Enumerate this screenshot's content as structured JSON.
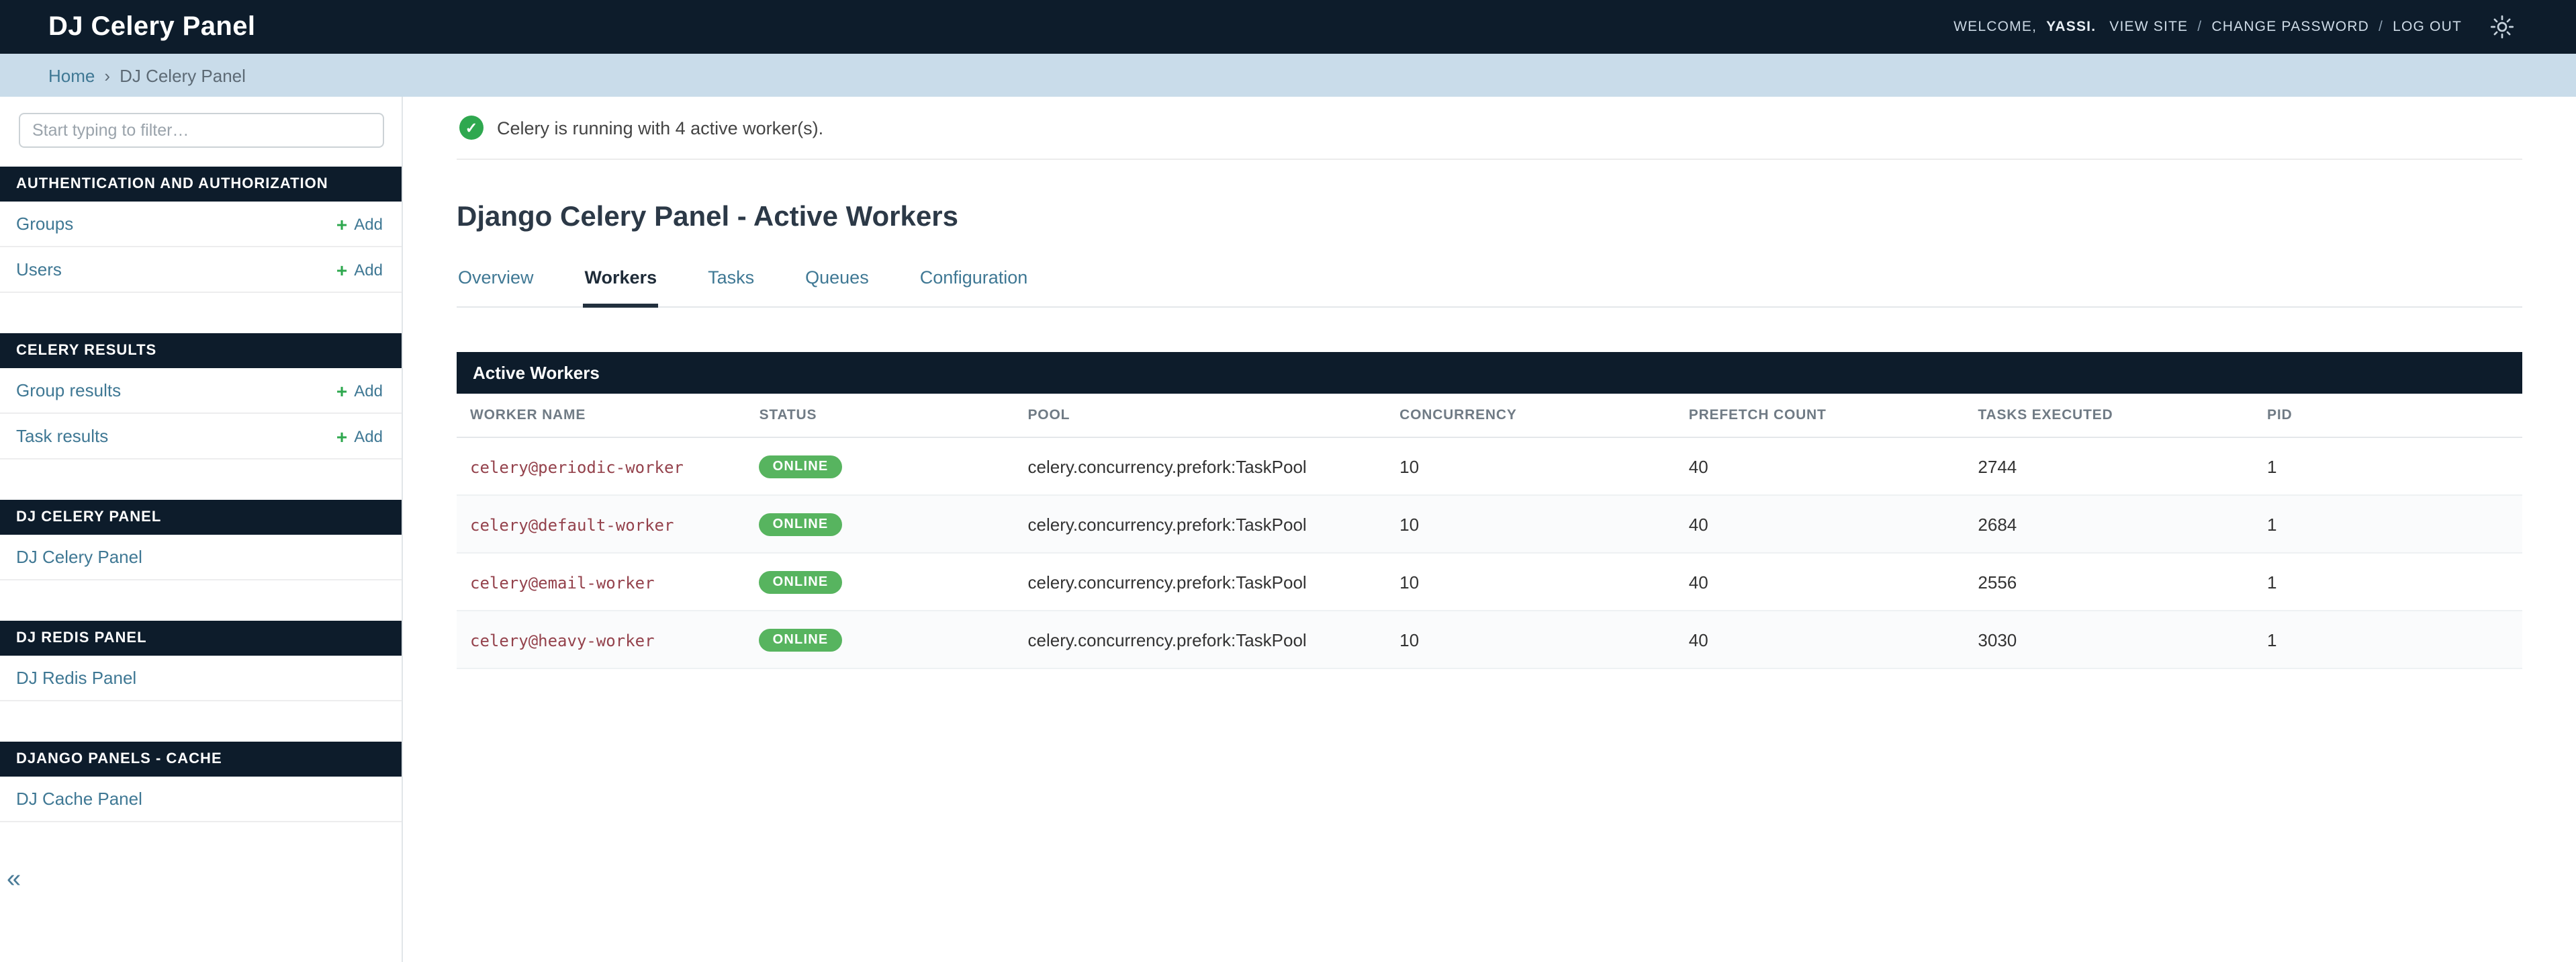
{
  "header": {
    "title": "DJ Celery Panel",
    "user_tools": {
      "welcome": "WELCOME,",
      "username": "YASSI.",
      "separator": "/",
      "links": [
        {
          "label": "VIEW SITE"
        },
        {
          "label": "CHANGE PASSWORD"
        },
        {
          "label": "LOG OUT"
        }
      ]
    }
  },
  "breadcrumbs": {
    "home": "Home",
    "separator": "›",
    "current": "DJ Celery Panel"
  },
  "sidebar": {
    "filter_placeholder": "Start typing to filter…",
    "add_label": "Add",
    "sections": [
      {
        "title": "AUTHENTICATION AND AUTHORIZATION",
        "items": [
          {
            "label": "Groups",
            "add": true
          },
          {
            "label": "Users",
            "add": true
          }
        ]
      },
      {
        "title": "CELERY RESULTS",
        "items": [
          {
            "label": "Group results",
            "add": true
          },
          {
            "label": "Task results",
            "add": true
          }
        ]
      },
      {
        "title": "DJ CELERY PANEL",
        "items": [
          {
            "label": "DJ Celery Panel",
            "add": false
          }
        ]
      },
      {
        "title": "DJ REDIS PANEL",
        "items": [
          {
            "label": "DJ Redis Panel",
            "add": false
          }
        ]
      },
      {
        "title": "DJANGO PANELS - CACHE",
        "items": [
          {
            "label": "DJ Cache Panel",
            "add": false
          }
        ]
      }
    ]
  },
  "message": {
    "text": "Celery is running with 4 active worker(s)."
  },
  "main": {
    "heading": "Django Celery Panel - Active Workers",
    "tabs": [
      {
        "label": "Overview",
        "active": false
      },
      {
        "label": "Workers",
        "active": true
      },
      {
        "label": "Tasks",
        "active": false
      },
      {
        "label": "Queues",
        "active": false
      },
      {
        "label": "Configuration",
        "active": false
      }
    ],
    "table": {
      "caption": "Active Workers",
      "columns": [
        "WORKER NAME",
        "STATUS",
        "POOL",
        "CONCURRENCY",
        "PREFETCH COUNT",
        "TASKS EXECUTED",
        "PID"
      ],
      "rows": [
        {
          "worker": "celery@periodic-worker",
          "status": "ONLINE",
          "pool": "celery.concurrency.prefork:TaskPool",
          "concurrency": "10",
          "prefetch_count": "40",
          "tasks_executed": "2744",
          "pid": "1"
        },
        {
          "worker": "celery@default-worker",
          "status": "ONLINE",
          "pool": "celery.concurrency.prefork:TaskPool",
          "concurrency": "10",
          "prefetch_count": "40",
          "tasks_executed": "2684",
          "pid": "1"
        },
        {
          "worker": "celery@email-worker",
          "status": "ONLINE",
          "pool": "celery.concurrency.prefork:TaskPool",
          "concurrency": "10",
          "prefetch_count": "40",
          "tasks_executed": "2556",
          "pid": "1"
        },
        {
          "worker": "celery@heavy-worker",
          "status": "ONLINE",
          "pool": "celery.concurrency.prefork:TaskPool",
          "concurrency": "10",
          "prefetch_count": "40",
          "tasks_executed": "3030",
          "pid": "1"
        }
      ]
    }
  },
  "icons": {
    "plus": "+",
    "check": "✓",
    "collapse": "«"
  },
  "colors": {
    "navy": "#0d1c2b",
    "breadcrumb_bg": "#c9dcea",
    "link": "#3f7894",
    "success_green": "#2fa84f",
    "badge_green": "#57b45f",
    "worker_link": "#94424c"
  }
}
